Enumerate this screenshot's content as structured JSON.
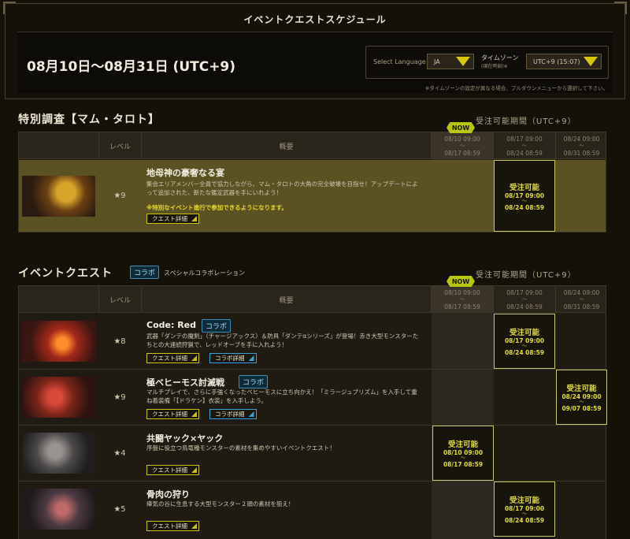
{
  "page": {
    "title": "イベントクエストスケジュール",
    "date_range": "08月10日〜08月31日 (UTC+9)"
  },
  "settings": {
    "language_label": "Select Language",
    "language_value": "JA",
    "timezone_label": "タイムゾーン",
    "timezone_sub": "(現在時刻)※",
    "timezone_value": "UTC+9 (15:07)",
    "note": "※タイムゾーンの設定が異なる場合、プルダウンメニューから選択して下さい。"
  },
  "columns": {
    "level": "レベル",
    "summary": "概要",
    "period_label": "受注可能期間（UTC+9）",
    "now": "NOW",
    "periods": [
      {
        "start": "08/10 09:00",
        "sep": "〜",
        "end": "08/17 08:59"
      },
      {
        "start": "08/17 09:00",
        "sep": "〜",
        "end": "08/24 08:59"
      },
      {
        "start": "08/24 09:00",
        "sep": "〜",
        "end": "08/31 08:59"
      }
    ]
  },
  "special": {
    "title": "特別調査【マム・タロト】",
    "quests": [
      {
        "level": "★9",
        "name": "地母神の豪奢なる宴",
        "desc": "集会エリアメンバー全員で協力しながら、マム・タロトの大角の完全破壊を目指せ！アップデートによって追加された、新たな鑑定武器を手にいれよう！",
        "note": "※特別なイベント進行で参加できるようになります。",
        "detail": "クエスト詳細",
        "avail": {
          "title": "受注可能",
          "start": "08/17 09:00",
          "sep": "〜",
          "end": "08/24 08:59"
        }
      }
    ]
  },
  "event": {
    "title": "イベントクエスト",
    "collab_badge": "コラボ",
    "collab_text": "スペシャルコラボレーション",
    "quests": [
      {
        "level": "★8",
        "name": "Code: Red",
        "badge": "コラボ",
        "desc": "武器「ダンテの魔剣」（チャージアックス）＆防具「ダンテαシリーズ」が登場！赤き大型モンスターたちとの大連続狩猟で、レッドオーブを手に入れよう！",
        "detail": "クエスト詳細",
        "collab_detail": "コラボ詳細",
        "avail": {
          "title": "受注可能",
          "start": "08/17 09:00",
          "sep": "〜",
          "end": "08/24 08:59"
        }
      },
      {
        "level": "★9",
        "name": "極ベヒーモス討滅戦",
        "badge": "コラボ",
        "desc": "マルチプレイで、さらに手強くなったベヒーモスに立ち向かえ！「ミラージュプリズム」を入手して重ね着装備「【ドラケン】衣装」を入手しよう。",
        "detail": "クエスト詳細",
        "collab_detail": "コラボ詳細",
        "avail": {
          "title": "受注可能",
          "start": "08/24 09:00",
          "sep": "〜",
          "end": "09/07 08:59"
        }
      },
      {
        "level": "★4",
        "name": "共闘ヤック×ヤック",
        "desc": "序盤に役立つ鳥竜種モンスターの素材を集めやすいイベントクエスト！",
        "detail": "クエスト詳細",
        "avail": {
          "title": "受注可能",
          "start": "08/10 09:00",
          "sep": "〜",
          "end": "08/17 08:59"
        }
      },
      {
        "level": "★5",
        "name": "骨肉の狩り",
        "desc": "瘴気の谷に生息する大型モンスター２頭の素材を狙え！",
        "detail": "クエスト詳細",
        "avail": {
          "title": "受注可能",
          "start": "08/17 09:00",
          "sep": "〜",
          "end": "08/24 08:59"
        }
      }
    ]
  }
}
